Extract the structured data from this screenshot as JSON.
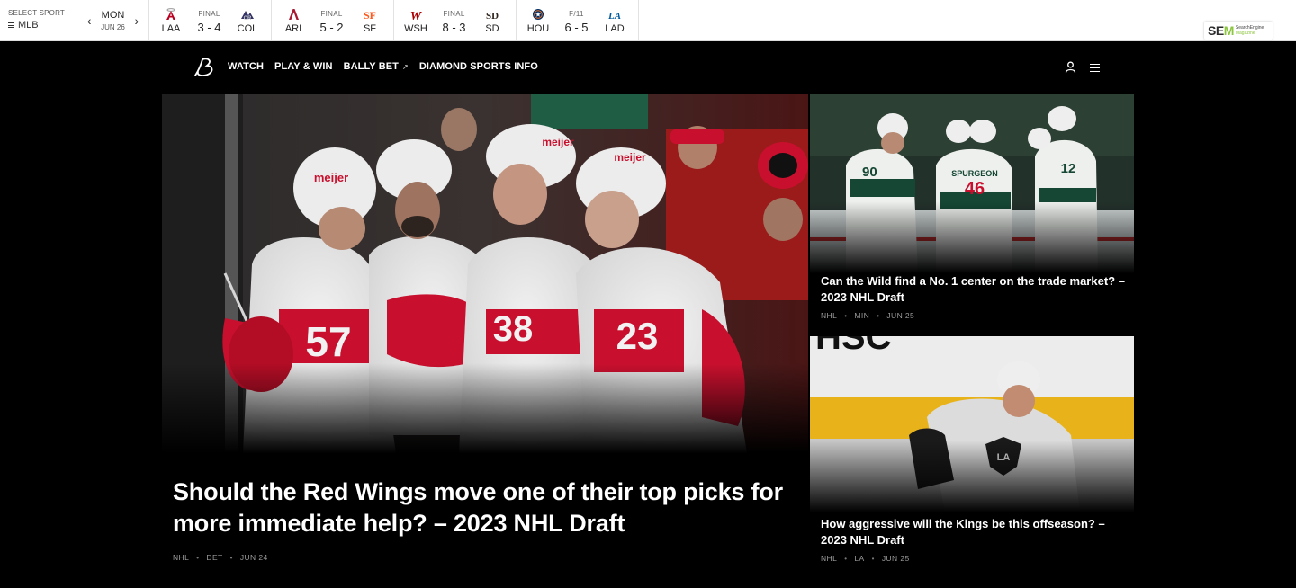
{
  "scores": {
    "select_label": "SELECT SPORT",
    "sport": "MLB",
    "day": "MON",
    "date": "JUN 26",
    "games": [
      {
        "status": "FINAL",
        "score": "3 - 4",
        "away": {
          "abbr": "LAA",
          "color": "#ba0021",
          "icon": "angels-logo"
        },
        "home": {
          "abbr": "COL",
          "color": "#333366",
          "icon": "rockies-logo"
        }
      },
      {
        "status": "FINAL",
        "score": "5 - 2",
        "away": {
          "abbr": "ARI",
          "color": "#a71930",
          "icon": "diamondbacks-logo"
        },
        "home": {
          "abbr": "SF",
          "color": "#fd5a1e",
          "icon": "giants-logo"
        }
      },
      {
        "status": "FINAL",
        "score": "8 - 3",
        "away": {
          "abbr": "WSH",
          "color": "#ab0003",
          "icon": "nationals-logo"
        },
        "home": {
          "abbr": "SD",
          "color": "#2f241d",
          "icon": "padres-logo"
        }
      },
      {
        "status": "F/11",
        "score": "6 - 5",
        "away": {
          "abbr": "HOU",
          "color": "#002d62",
          "icon": "astros-logo"
        },
        "home": {
          "abbr": "LAD",
          "color": "#005a9c",
          "icon": "dodgers-logo"
        }
      }
    ]
  },
  "watermark": {
    "brand_a": "SE",
    "brand_b": "M",
    "sub1": "SearchEngine",
    "sub2": "Magazine"
  },
  "nav": {
    "links": [
      "WATCH",
      "PLAY & WIN",
      "BALLY BET",
      "DIAMOND SPORTS INFO"
    ],
    "external_mark": "↗"
  },
  "hero": {
    "title": "Should the Red Wings move one of their top picks for more immediate help? – 2023 NHL Draft",
    "meta": [
      "NHL",
      "DET",
      "JUN 24"
    ],
    "jersey_brand": "meijer",
    "jersey_numbers": [
      "57",
      "38",
      "23"
    ]
  },
  "cards": [
    {
      "title": "Can the Wild find a No. 1 center on the trade market? – 2023 NHL Draft",
      "meta": [
        "NHL",
        "MIN",
        "JUN 25"
      ],
      "jersey_numbers": [
        "90",
        "46",
        "12"
      ],
      "jersey_name": "SPURGEON"
    },
    {
      "title": "How aggressive will the Kings be this offseason? – 2023 NHL Draft",
      "meta": [
        "NHL",
        "LA",
        "JUN 25"
      ],
      "board_text": "HSC",
      "crest_text": "LA"
    }
  ],
  "colors": {
    "accent_red": "#c8102e",
    "wild_green": "#154734",
    "rink_yellow": "#e8b31a"
  }
}
